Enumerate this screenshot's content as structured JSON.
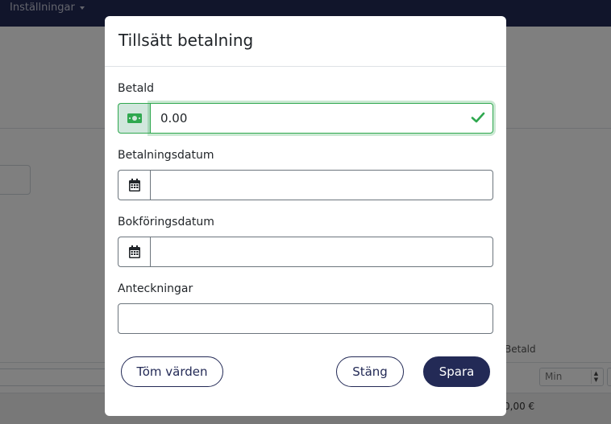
{
  "navbar": {
    "menu_label": "Inställningar"
  },
  "background": {
    "column_label": "Betald",
    "min_placeholder": "Min",
    "total_value": "0,00 €"
  },
  "modal": {
    "title": "Tillsätt betalning",
    "fields": {
      "paid": {
        "label": "Betald",
        "value": "0.00",
        "icon": "money-bill-icon",
        "valid_icon": "checkmark-icon"
      },
      "payment_date": {
        "label": "Betalningsdatum",
        "value": "",
        "icon": "calendar-icon"
      },
      "booking_date": {
        "label": "Bokföringsdatum",
        "value": "",
        "icon": "calendar-icon"
      },
      "notes": {
        "label": "Anteckningar",
        "value": ""
      }
    },
    "buttons": {
      "clear": "Töm värden",
      "close": "Stäng",
      "save": "Spara"
    }
  },
  "colors": {
    "navbar": "#232a56",
    "primary": "#232a56",
    "valid": "#2fa84f",
    "valid_bg": "#d1e7dd"
  }
}
